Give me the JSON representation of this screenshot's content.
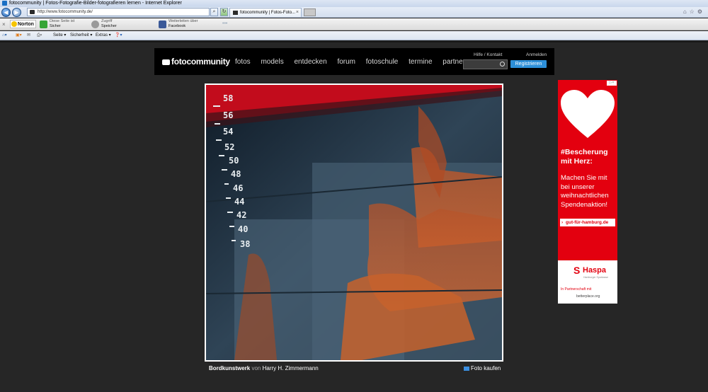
{
  "browser": {
    "window_title": "fotocommunity | Fotos-Fotografie-Bilder-fotografieren lernen - Internet Explorer",
    "address": "http://www.fotocommunity.de/",
    "tab_label": "fotocommunity | Fotos-Foto...",
    "norton_label": "Norton",
    "norton_items": [
      {
        "line1": "Diese Seite ist",
        "line2": "Sicher"
      },
      {
        "line1": "Zugriff",
        "line2": "Speicher"
      },
      {
        "line1": "Weiterleiten über",
        "line2": "Facebook"
      }
    ],
    "command_items": [
      "Seite ▾",
      "Sicherheit ▾",
      "Extras ▾"
    ]
  },
  "site": {
    "logo": "fotocommunity",
    "nav": [
      "fotos",
      "models",
      "entdecken",
      "forum",
      "fotoschule",
      "termine",
      "partner"
    ],
    "help_link": "Hilfe / Kontakt",
    "login_link": "Anmelden",
    "register_button": "Registrieren",
    "search_placeholder": ""
  },
  "photo": {
    "title": "Bordkunstwerk",
    "by": "von",
    "author": "Harry H. Zimmermann",
    "buy_label": "Foto kaufen",
    "draft_marks": [
      "58",
      "56",
      "54",
      "52",
      "50",
      "48",
      "46",
      "44",
      "42",
      "40",
      "38"
    ]
  },
  "ad": {
    "headline": "#Bescherung mit Herz:",
    "body": "Machen Sie mit bei unserer weihnachtlichen Spendenaktion!",
    "link": "gut-für-hamburg.de",
    "brand": "Haspa",
    "brand_sub": "Hamburger Sparkasse",
    "partner_line": "In Partnerschaft mit",
    "partner": "betterplace.org"
  }
}
